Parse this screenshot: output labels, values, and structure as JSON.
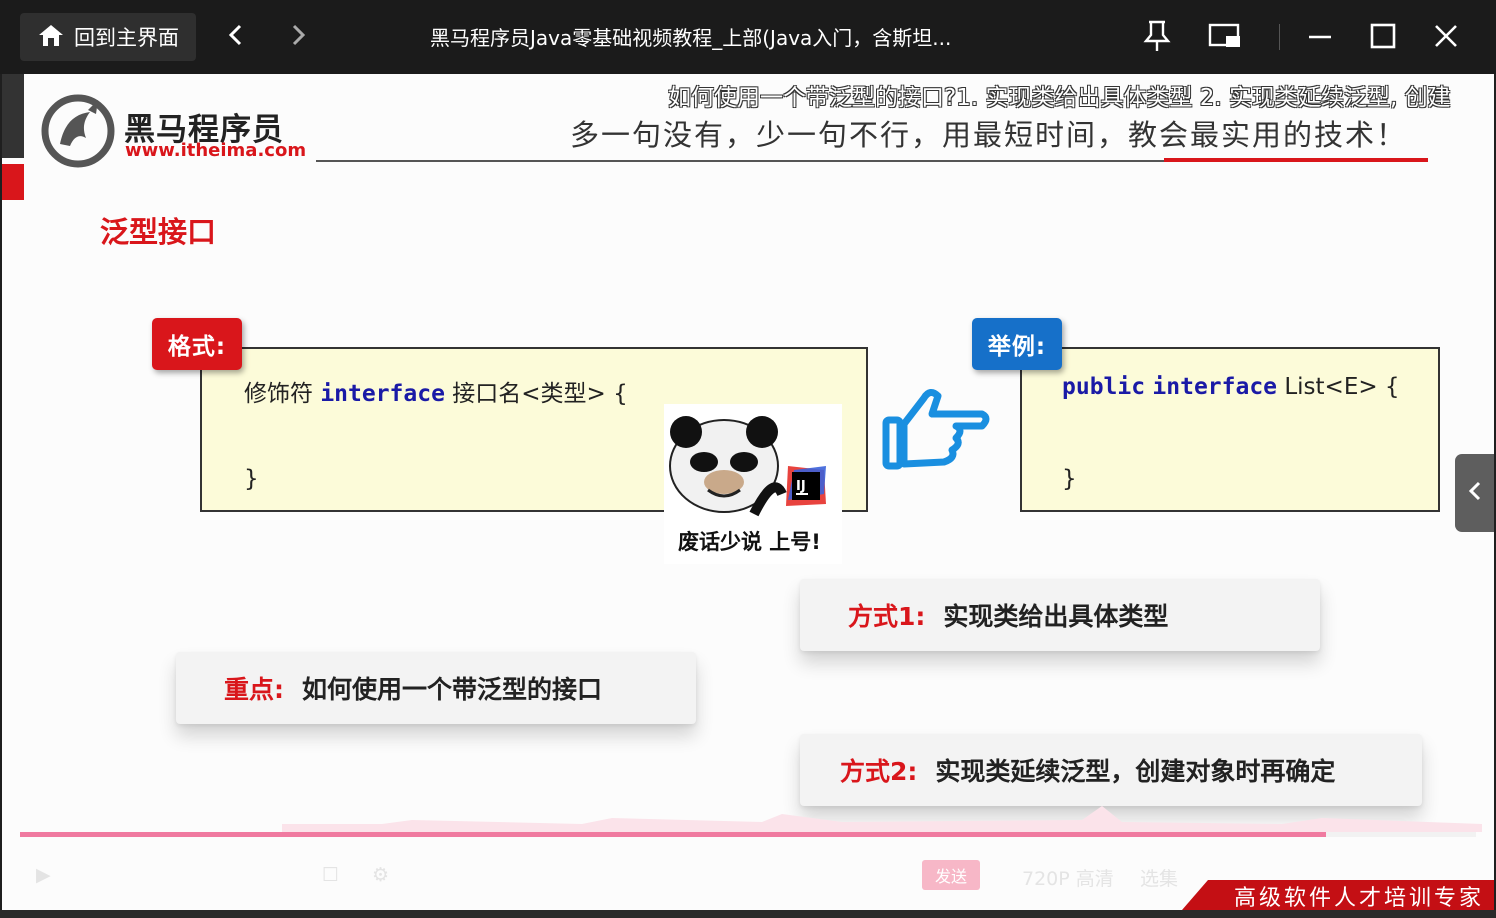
{
  "window": {
    "home_label": "回到主界面",
    "title": "黑马程序员Java零基础视频教程_上部(Java入门，含斯坦...",
    "icons": [
      "home-icon",
      "back-arrow-icon",
      "forward-arrow-icon",
      "pin-icon",
      "mini-window-icon",
      "minimize-icon",
      "maximize-icon",
      "close-icon"
    ]
  },
  "slide": {
    "caption": "如何使用一个带泛型的接口?1. 实现类给出具体类型 2. 实现类延续泛型, 创建",
    "brand_name": "黑马程序员",
    "brand_url": "www.itheima.com",
    "slogan": "多一句没有，少一句不行，用最短时间，教会最实用的技术！",
    "title": "泛型接口",
    "format": {
      "tag": "格式:",
      "modifier": "修饰符",
      "keyword": "interface",
      "rest": "接口名<类型> {",
      "close": "}"
    },
    "example": {
      "tag": "举例:",
      "keyword1": "public",
      "keyword2": "interface",
      "rest": "List<E> {",
      "close": "}"
    },
    "meme_text": "废话少说 上号!",
    "meme_ij": "IJ",
    "method1": {
      "label": "方式1:",
      "text": "实现类给出具体类型"
    },
    "key_point": {
      "label": "重点:",
      "text": "如何使用一个带泛型的接口"
    },
    "method2": {
      "label": "方式2:",
      "text": "实现类延续泛型，创建对象时再确定"
    }
  },
  "player": {
    "progress_fraction": 0.897,
    "send_label": "发送",
    "quality_label": "720P 高清",
    "select_label": "选集",
    "corner_text": "高级软件人才培训专家"
  },
  "colors": {
    "brand_red": "#d9161b",
    "example_blue": "#1670c9",
    "progress_pink": "#f07aa0"
  }
}
